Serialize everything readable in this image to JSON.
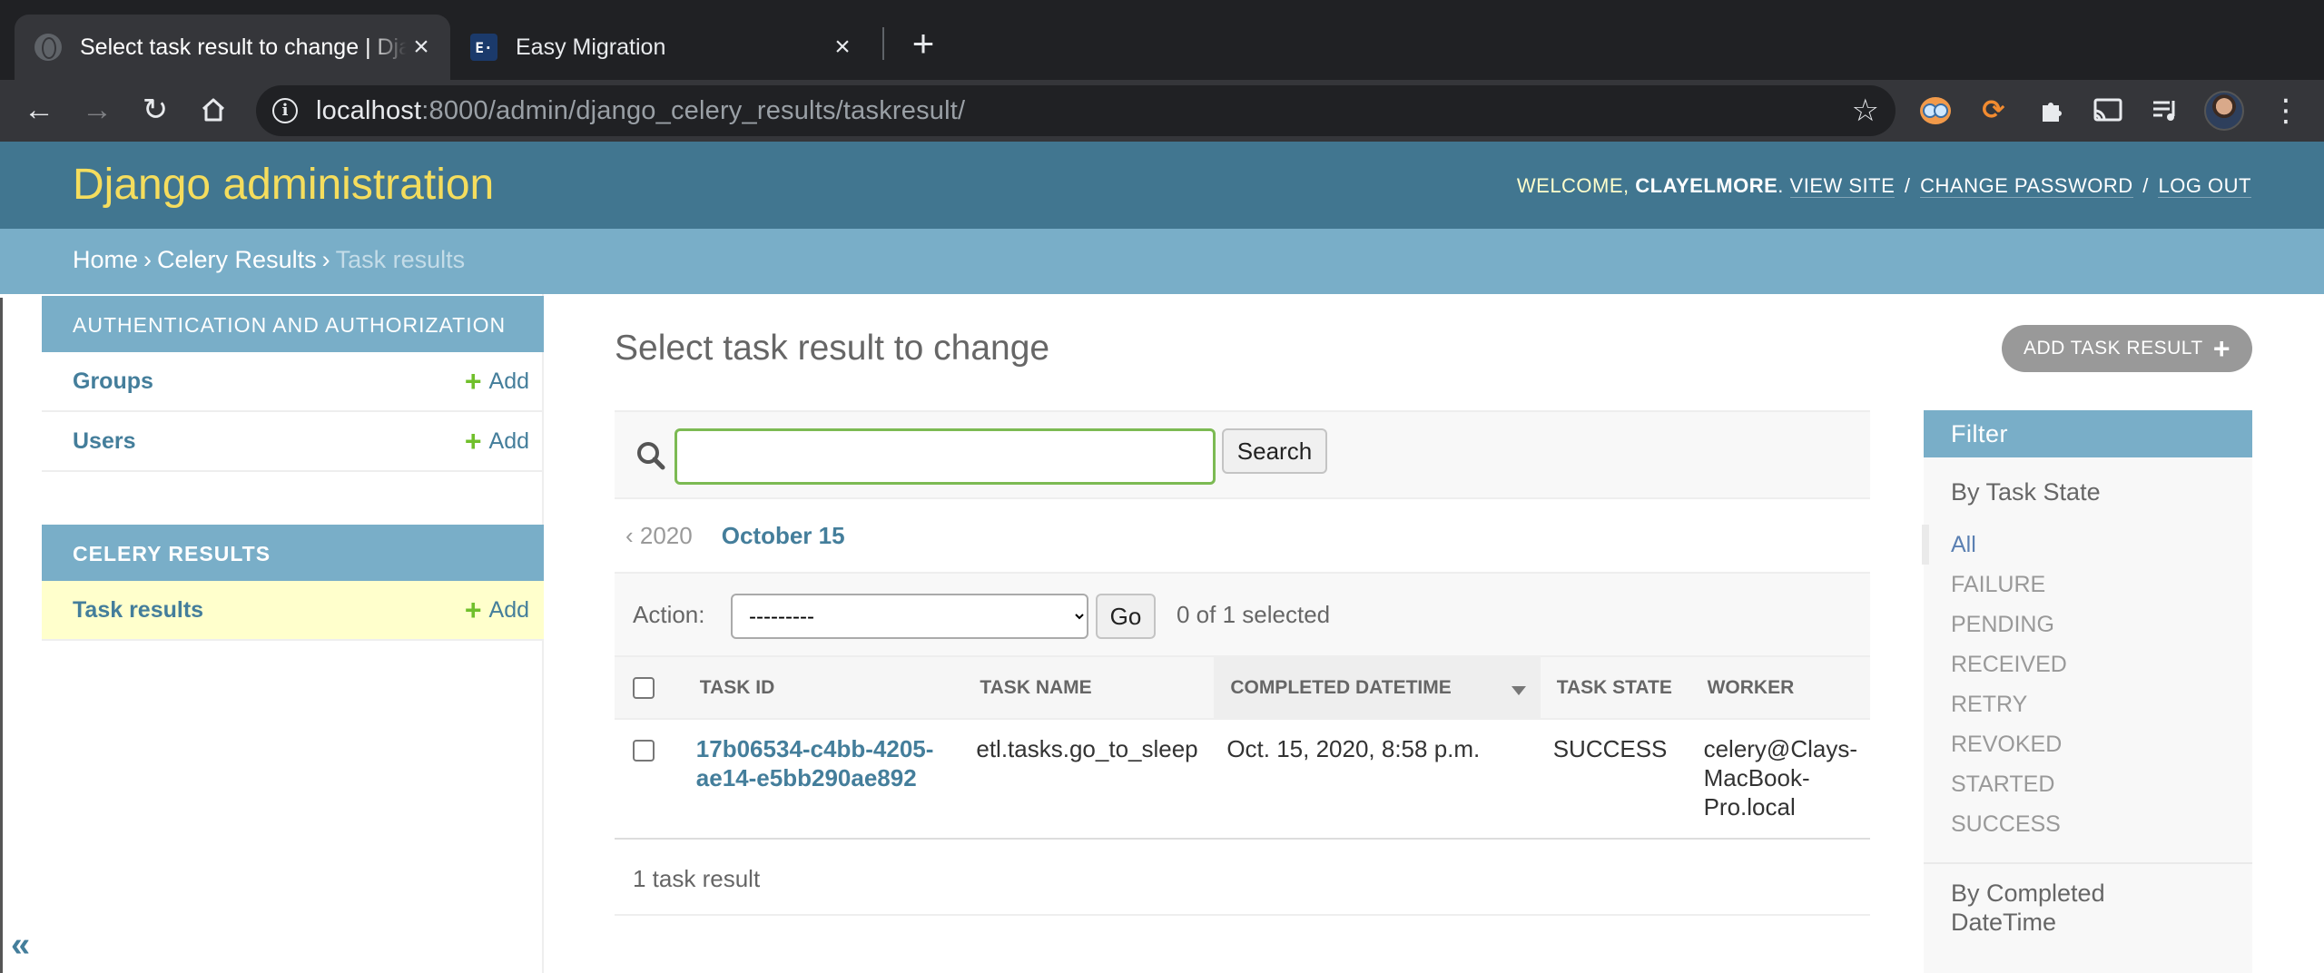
{
  "browser": {
    "tabs": [
      {
        "title": "Select task result to change | Django site admin",
        "active": true,
        "favicon": "globe-icon"
      },
      {
        "title": "Easy Migration",
        "active": false,
        "favicon": "easy-migration-icon"
      }
    ],
    "url_host": "localhost",
    "url_rest": ":8000/admin/django_celery_results/taskresult/"
  },
  "header": {
    "branding": "Django administration",
    "welcome": "Welcome,",
    "username": "clayelmore",
    "view_site": "View site",
    "change_password": "Change password",
    "log_out": "Log out"
  },
  "breadcrumbs": {
    "home": "Home",
    "app": "Celery Results",
    "current": "Task results"
  },
  "sidebar": {
    "modules": [
      {
        "caption": "Authentication and Authorization",
        "rows": [
          {
            "model": "Groups",
            "add": "Add"
          },
          {
            "model": "Users",
            "add": "Add"
          }
        ]
      },
      {
        "caption": "Celery Results",
        "rows": [
          {
            "model": "Task results",
            "add": "Add",
            "current": true
          }
        ]
      }
    ],
    "collapse": "«"
  },
  "content": {
    "title": "Select task result to change",
    "add_button": "Add task result",
    "search": {
      "value": "",
      "button": "Search"
    },
    "date_hierarchy": {
      "back": "‹ 2020",
      "current": "October 15"
    },
    "actions": {
      "label": "Action:",
      "selected_option": "---------",
      "go": "Go",
      "counter": "0 of 1 selected"
    },
    "table": {
      "columns": [
        "Task ID",
        "Task name",
        "Completed datetime",
        "Task state",
        "Worker"
      ],
      "sorted_column": "Completed datetime",
      "rows": [
        {
          "task_id": "17b06534-c4bb-4205-ae14-e5bb290ae892",
          "task_id_line1": "17b06534-c4bb-4205-",
          "task_id_line2": "ae14-e5bb290ae892",
          "task_name": "etl.tasks.go_to_sleep",
          "completed": "Oct. 15, 2020, 8:58 p.m.",
          "state": "SUCCESS",
          "worker_line1": "celery@Clays-",
          "worker_line2": "MacBook-",
          "worker_line3": "Pro.local"
        }
      ]
    },
    "paginator": "1 task result"
  },
  "filter": {
    "title": "Filter",
    "groups": [
      {
        "heading": "By Task State",
        "options": [
          "All",
          "FAILURE",
          "PENDING",
          "RECEIVED",
          "RETRY",
          "REVOKED",
          "STARTED",
          "SUCCESS"
        ],
        "selected": "All"
      },
      {
        "heading_line1": "By Completed",
        "heading_line2": "DateTime"
      }
    ]
  }
}
